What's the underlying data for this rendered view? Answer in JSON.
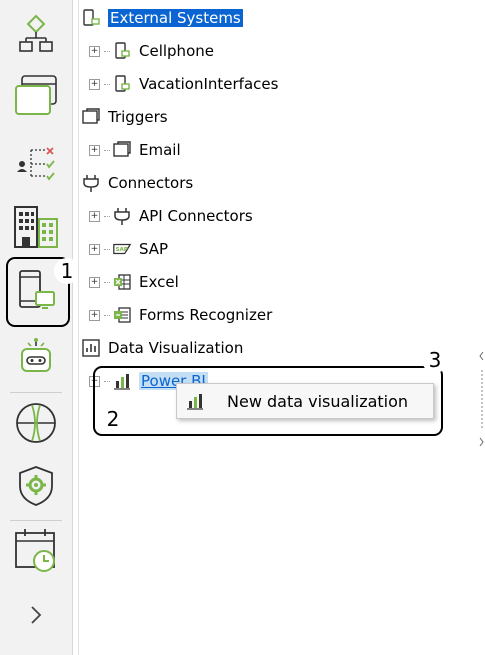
{
  "sidebar": {
    "items": [
      {
        "name": "process-icon"
      },
      {
        "name": "window-icon"
      },
      {
        "name": "roles-icon"
      },
      {
        "name": "organization-icon"
      },
      {
        "name": "integrations-icon"
      },
      {
        "name": "bot-icon"
      },
      {
        "name": "globe-icon"
      },
      {
        "name": "security-shield-icon"
      },
      {
        "name": "calendar-icon"
      },
      {
        "name": "chevron-right-icon"
      }
    ]
  },
  "tree": {
    "external_systems": "External Systems",
    "cellphone": "Cellphone",
    "vacation_interfaces": "VacationInterfaces",
    "triggers": "Triggers",
    "email": "Email",
    "connectors": "Connectors",
    "api_connectors": "API Connectors",
    "sap": "SAP",
    "excel": "Excel",
    "forms_recognizer": "Forms Recognizer",
    "data_visualization": "Data Visualization",
    "power_bi": "Power BI"
  },
  "context_menu": {
    "new_data_visualization": "New data visualization"
  },
  "annotations": {
    "badge1": "1",
    "badge2": "2",
    "badge3": "3"
  },
  "colors": {
    "selection": "#0a64d1",
    "highlight": "#c4def3",
    "icon_green": "#7ab648",
    "icon_dark": "#333333"
  }
}
